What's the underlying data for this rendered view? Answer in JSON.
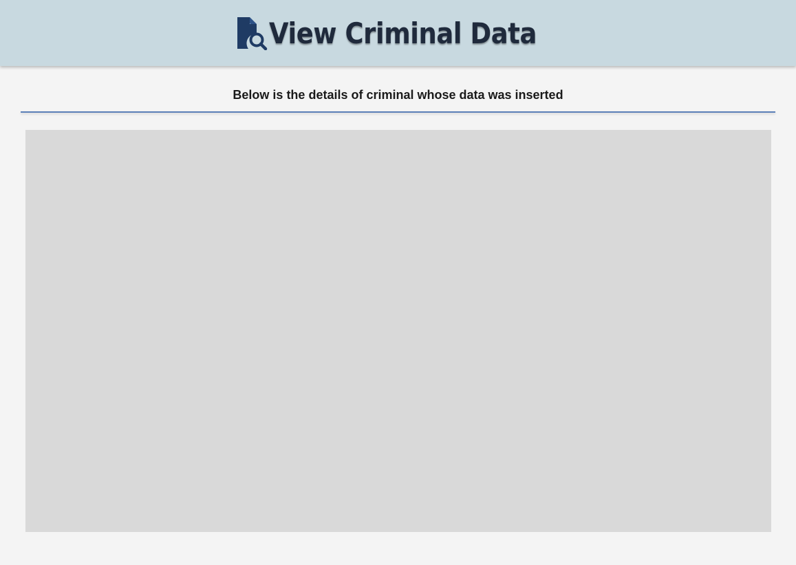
{
  "header": {
    "title": "View Criminal Data",
    "icon": "file-search-icon",
    "background": "#c8d9e0",
    "title_color": "#1f2a3c"
  },
  "main": {
    "subtitle": "Below is the details of criminal whose data was inserted",
    "divider_color": "#5a7fb7",
    "panel_color": "#d9d9d9"
  }
}
